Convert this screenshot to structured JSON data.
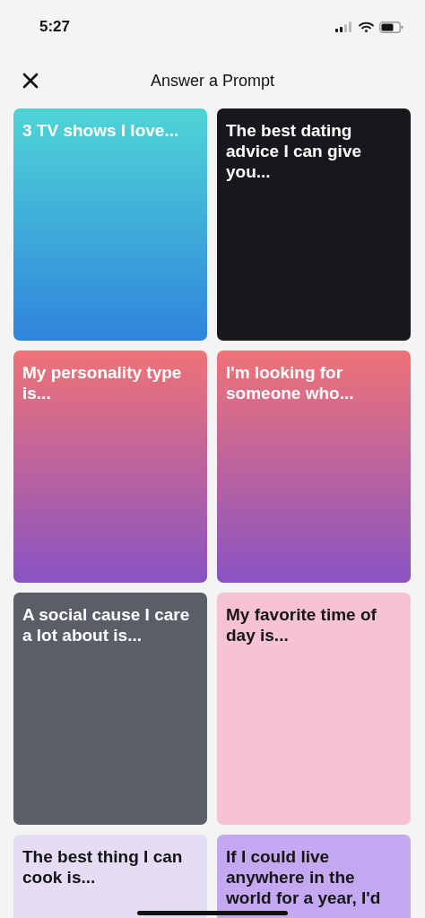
{
  "status_bar": {
    "time": "5:27"
  },
  "header": {
    "title": "Answer a Prompt"
  },
  "prompts": [
    {
      "text": "3 TV shows I love...",
      "kind": "ocean"
    },
    {
      "text": "The best dating advice I can give you...",
      "kind": "plain",
      "color": "#17181c"
    },
    {
      "text": "My personality type is...",
      "kind": "sunset"
    },
    {
      "text": "I'm looking for someone who...",
      "kind": "sunset"
    },
    {
      "text": "A social cause I care a lot about is...",
      "kind": "plain",
      "color": "#5a5f67"
    },
    {
      "text": "My favorite time of day is...",
      "kind": "plain",
      "color": "#f7c3d3"
    },
    {
      "text": "The best thing I can cook is...",
      "kind": "plain",
      "color": "#e5ddf6"
    },
    {
      "text": "If I could live anywhere in the world for a year, I'd",
      "kind": "plain",
      "color": "#c4a9f2"
    }
  ]
}
